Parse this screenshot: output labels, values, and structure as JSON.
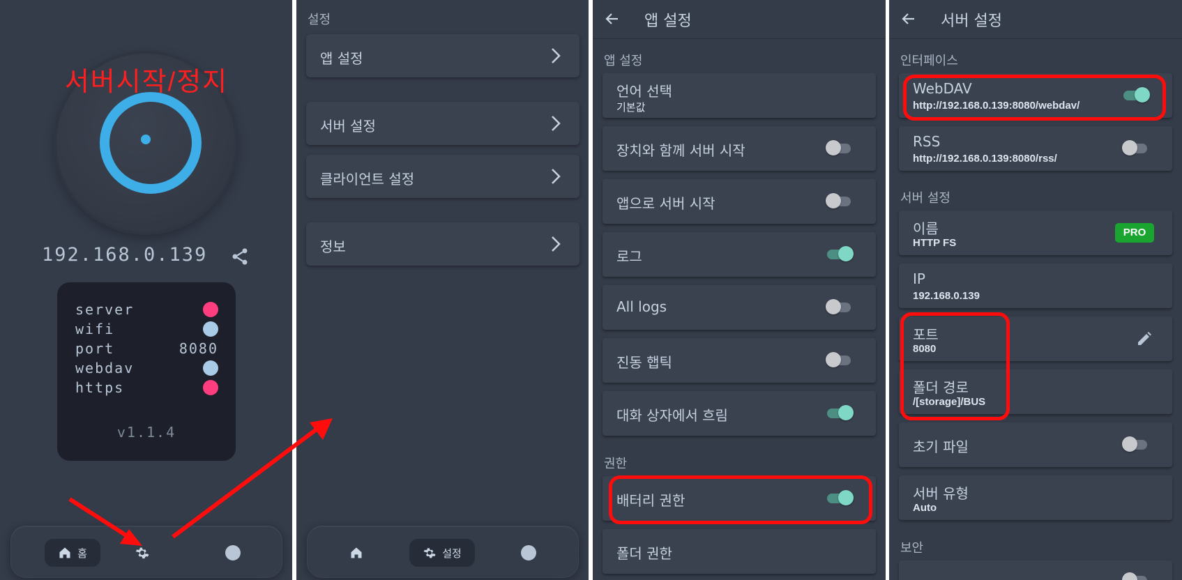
{
  "panel_home": {
    "annotation": "서버시작/정지",
    "ip": "192.168.0.139",
    "status": [
      {
        "label": "server",
        "kind": "dot",
        "color": "#ff3d7f"
      },
      {
        "label": "wifi",
        "kind": "dot",
        "color": "#a9cbe6"
      },
      {
        "label": "port",
        "kind": "value",
        "value": "8080"
      },
      {
        "label": "webdav",
        "kind": "dot",
        "color": "#a9cbe6"
      },
      {
        "label": "https",
        "kind": "dot",
        "color": "#ff3d7f"
      }
    ],
    "version": "v1.1.4",
    "nav": {
      "home_label": "홈"
    }
  },
  "panel_settings": {
    "section": "설정",
    "items": [
      "앱 설정",
      "서버 설정",
      "클라이언트 설정",
      "정보"
    ],
    "nav": {
      "settings_label": "설정"
    }
  },
  "panel_app_settings": {
    "title": "앱 설정",
    "section_app": "앱 설정",
    "language": {
      "title": "언어 선택",
      "value": "기본값"
    },
    "rows": [
      {
        "title": "장치와 함께 서버 시작",
        "on": false
      },
      {
        "title": "앱으로 서버 시작",
        "on": false
      },
      {
        "title": "로그",
        "on": true
      },
      {
        "title": "All logs",
        "on": false
      },
      {
        "title": "진동 햅틱",
        "on": false
      },
      {
        "title": "대화 상자에서 흐림",
        "on": true
      }
    ],
    "section_perm": "권한",
    "battery": {
      "title": "배터리 권한",
      "on": true
    },
    "folder_perm": "폴더 권한"
  },
  "panel_server_settings": {
    "title": "서버 설정",
    "section_interface": "인터페이스",
    "webdav": {
      "title": "WebDAV",
      "url": "http://192.168.0.139:8080/webdav/",
      "on": true
    },
    "rss": {
      "title": "RSS",
      "url": "http://192.168.0.139:8080/rss/",
      "on": false
    },
    "section_server": "서버 설정",
    "name": {
      "title": "이름",
      "value": "HTTP FS",
      "badge": "PRO"
    },
    "ip": {
      "title": "IP",
      "value": "192.168.0.139"
    },
    "port": {
      "title": "포트",
      "value": "8080"
    },
    "folder": {
      "title": "폴더 경로",
      "value": "/[storage]/BUS"
    },
    "init_file": {
      "title": "초기 파일",
      "on": false
    },
    "server_type": {
      "title": "서버 유형",
      "value": "Auto"
    },
    "section_security": "보안"
  },
  "colors": {
    "annotation_red": "#ff1f1f",
    "accent_blue": "#3eaee8",
    "toggle_on": "#7fd8c5",
    "pro_green": "#1aa531"
  }
}
